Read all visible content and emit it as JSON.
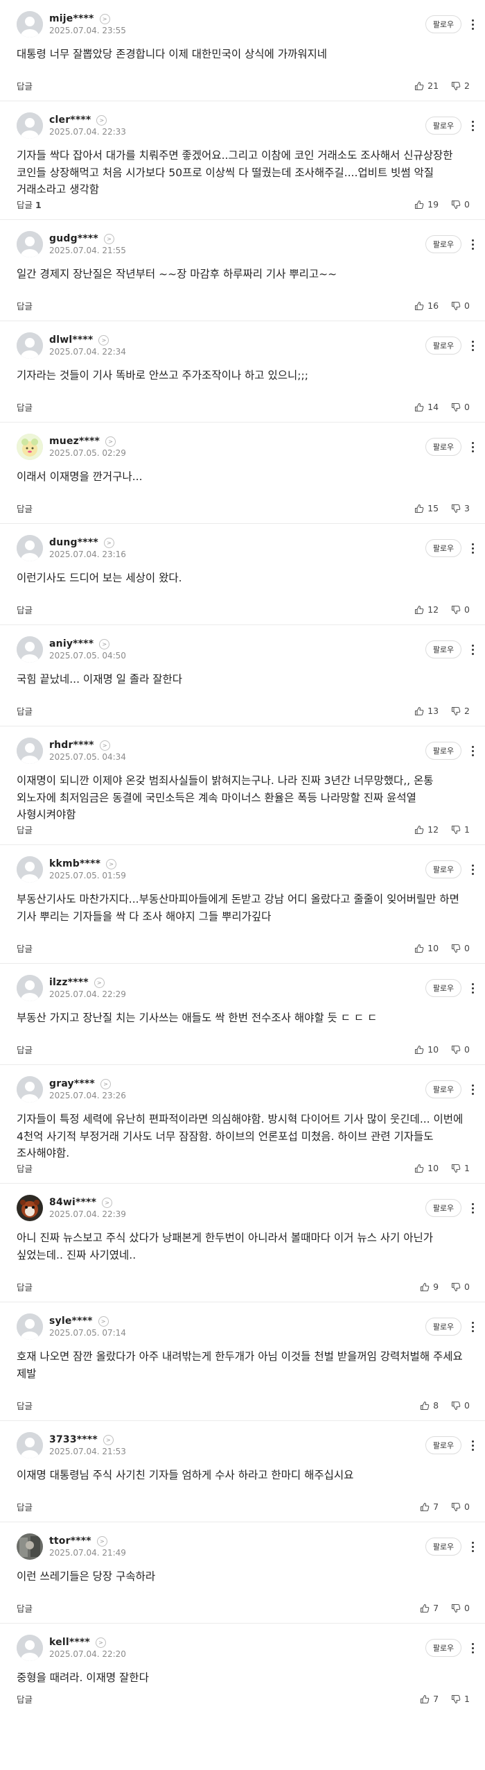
{
  "ui": {
    "follow_label": "팔로우",
    "reply_label": "답글",
    "info_glyph": ">"
  },
  "comments": [
    {
      "nick": "mije****",
      "date": "2025.07.04. 23:55",
      "text": "대통령 너무 잘뽑았당 존경합니다 이제 대한민국이 상식에 가까워지네",
      "reply_count": "",
      "up": "21",
      "down": "2"
    },
    {
      "nick": "cler****",
      "date": "2025.07.04. 22:33",
      "text": "기자들 싹다 잡아서 대가를 치뤄주면 좋겠어요..그리고 이참에 코인 거래소도 조사해서 신규상장한 코인들 상장해먹고 처음 시가보다 50프로 이상씩 다 떨궜는데 조사해주길....업비트 빗썸 악질 거래소라고 생각함",
      "reply_count": "1",
      "up": "19",
      "down": "0"
    },
    {
      "nick": "gudg****",
      "date": "2025.07.04. 21:55",
      "text": "일간 경제지 장난질은 작년부터 ~~장 마감후 하루짜리 기사 뿌리고~~",
      "reply_count": "",
      "up": "16",
      "down": "0"
    },
    {
      "nick": "dlwl****",
      "date": "2025.07.04. 22:34",
      "text": "기자라는 것들이 기사 똑바로 안쓰고 주가조작이나 하고 있으니;;;",
      "reply_count": "",
      "up": "14",
      "down": "0"
    },
    {
      "nick": "muez****",
      "date": "2025.07.05. 02:29",
      "text": "이래서 이재명을 깐거구나...",
      "reply_count": "",
      "up": "15",
      "down": "3"
    },
    {
      "nick": "dung****",
      "date": "2025.07.04. 23:16",
      "text": "이런기사도 드디어 보는 세상이 왔다.",
      "reply_count": "",
      "up": "12",
      "down": "0"
    },
    {
      "nick": "aniy****",
      "date": "2025.07.05. 04:50",
      "text": "국힘 끝났네... 이재명 일 졸라 잘한다",
      "reply_count": "",
      "up": "13",
      "down": "2"
    },
    {
      "nick": "rhdr****",
      "date": "2025.07.05. 04:34",
      "text": "이재명이 되니깐 이제야 온갖 범죄사실들이 밝혀지는구나. 나라 진짜 3년간 너무망했다,, 온통 외노자에 최저임금은 동결에 국민소득은 계속 마이너스 환율은 폭등 나라망할 진짜 윤석열 사형시켜야함",
      "reply_count": "",
      "up": "12",
      "down": "1"
    },
    {
      "nick": "kkmb****",
      "date": "2025.07.05. 01:59",
      "text": "부동산기사도 마찬가지다...부동산마피아들에게 돈받고 강남 어디 올랐다고 줄줄이 잊어버릴만 하면 기사 뿌리는 기자들을 싹 다 조사 해야지 그들 뿌리가깊다",
      "reply_count": "",
      "up": "10",
      "down": "0"
    },
    {
      "nick": "ilzz****",
      "date": "2025.07.04. 22:29",
      "text": "부동산 가지고 장난질 치는 기사쓰는 애들도 싹 한번 전수조사 해야할 듯 ㄷ ㄷ ㄷ",
      "reply_count": "",
      "up": "10",
      "down": "0"
    },
    {
      "nick": "gray****",
      "date": "2025.07.04. 23:26",
      "text": "기자들이 특정 세력에 유난히 편파적이라면 의심해야함. 방시혁 다이어트 기사 많이 웃긴데... 이번에 4천억 사기적 부정거래 기사도 너무 잠잠함. 하이브의 언론포섭 미쳤음. 하이브 관련 기자들도 조사해야함.",
      "reply_count": "",
      "up": "10",
      "down": "1"
    },
    {
      "nick": "84wi****",
      "date": "2025.07.04. 22:39",
      "text": "아니 진짜 뉴스보고 주식 샀다가 낭패본게 한두번이 아니라서 볼때마다 이거 뉴스 사기 아닌가 싶었는데.. 진짜 사기였네..",
      "reply_count": "",
      "up": "9",
      "down": "0"
    },
    {
      "nick": "syle****",
      "date": "2025.07.05. 07:14",
      "text": "호재 나오면 잠깐 올랐다가 아주 내려밖는게 한두개가 아님 이것들 천벌 받을꺼임 강력처벌해 주세요 제발",
      "reply_count": "",
      "up": "8",
      "down": "0"
    },
    {
      "nick": "3733****",
      "date": "2025.07.04. 21:53",
      "text": "이재명 대통령님 주식 사기친 기자들 엄하게 수사 하라고 한마디 해주십시요",
      "reply_count": "",
      "up": "7",
      "down": "0"
    },
    {
      "nick": "ttor****",
      "date": "2025.07.04. 21:49",
      "text": "이런 쓰레기들은 당장 구속하라",
      "reply_count": "",
      "up": "7",
      "down": "0"
    },
    {
      "nick": "kell****",
      "date": "2025.07.04. 22:20",
      "text": "중형을 때려라. 이재명 잘한다",
      "reply_count": "",
      "up": "7",
      "down": "1"
    }
  ]
}
